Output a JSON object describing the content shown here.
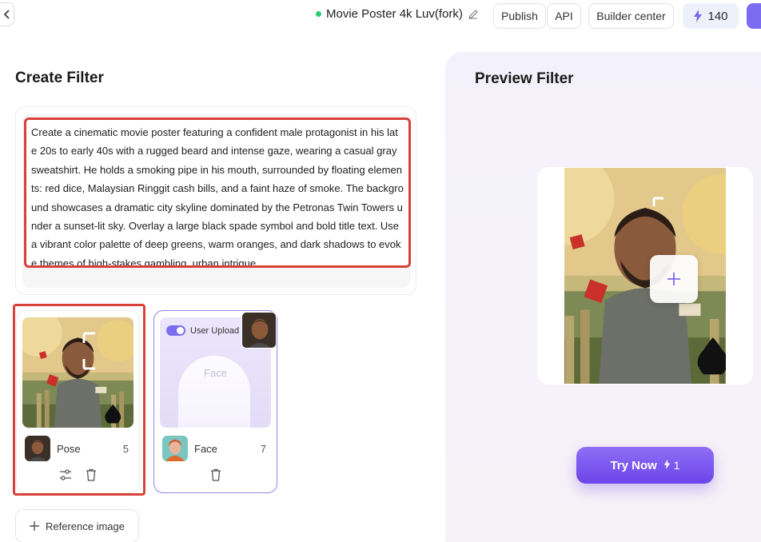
{
  "header": {
    "project_title": "Movie Poster 4k Luv(fork)",
    "publish_label": "Publish",
    "api_label": "API",
    "builder_center_label": "Builder center",
    "energy_count": "140"
  },
  "create_filter": {
    "title": "Create Filter",
    "prompt": "Create a cinematic movie poster featuring a confident male protagonist in his late 20s to early 40s with a rugged beard and intense gaze, wearing a casual gray sweatshirt. He holds a smoking pipe in his mouth, surrounded by floating elements: red dice, Malaysian Ringgit cash bills, and a faint haze of smoke. The background showcases a dramatic city skyline dominated by the Petronas Twin Towers under a sunset-lit sky. Overlay a large black spade symbol and bold title text. Use a vibrant color palette of deep greens, warm oranges, and dark shadows to evoke themes of high-stakes gambling, urban intrigue"
  },
  "reference_cards": [
    {
      "label": "Pose",
      "count": "5"
    },
    {
      "label": "Face",
      "count": "7",
      "toggle_label": "User Upload",
      "placeholder": "Face"
    }
  ],
  "reference_button_label": "Reference image",
  "preview_filter": {
    "title": "Preview Filter",
    "try_label": "Try Now",
    "try_cost": "1"
  },
  "colors": {
    "accent": "#7a6ef0",
    "highlight": "#d9403a",
    "status": "#2ecc71"
  }
}
